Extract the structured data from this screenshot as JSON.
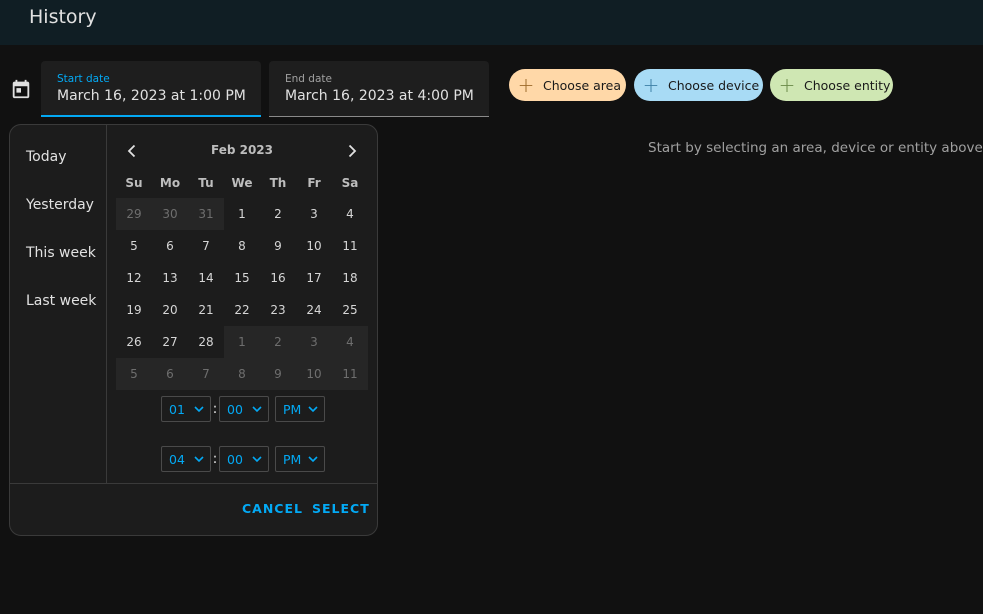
{
  "header": {
    "title": "History"
  },
  "start_field": {
    "label": "Start date",
    "value": "March 16, 2023 at 1:00 PM"
  },
  "end_field": {
    "label": "End date",
    "value": "March 16, 2023 at 4:00 PM"
  },
  "chips": [
    {
      "label": "Choose area",
      "color": "#ffd8a8"
    },
    {
      "label": "Choose device",
      "color": "#a8dbf5"
    },
    {
      "label": "Choose entity",
      "color": "#cfe7b3"
    }
  ],
  "hint": "Start by selecting an area, device or entity above",
  "picker": {
    "ranges": [
      "Today",
      "Yesterday",
      "This week",
      "Last week"
    ],
    "month_label": "Feb 2023",
    "weekdays": [
      "Su",
      "Mo",
      "Tu",
      "We",
      "Th",
      "Fr",
      "Sa"
    ],
    "weeks": [
      [
        "29",
        "30",
        "31",
        "1",
        "2",
        "3",
        "4"
      ],
      [
        "5",
        "6",
        "7",
        "8",
        "9",
        "10",
        "11"
      ],
      [
        "12",
        "13",
        "14",
        "15",
        "16",
        "17",
        "18"
      ],
      [
        "19",
        "20",
        "21",
        "22",
        "23",
        "24",
        "25"
      ],
      [
        "26",
        "27",
        "28",
        "1",
        "2",
        "3",
        "4"
      ],
      [
        "5",
        "6",
        "7",
        "8",
        "9",
        "10",
        "11"
      ]
    ],
    "start_time": {
      "hour": "01",
      "minute": "00",
      "ampm": "PM"
    },
    "end_time": {
      "hour": "04",
      "minute": "00",
      "ampm": "PM"
    },
    "cancel_label": "CANCEL",
    "select_label": "SELECT"
  },
  "colors": {
    "accent": "#03a9f4",
    "background": "#111111",
    "header": "#101e24"
  }
}
